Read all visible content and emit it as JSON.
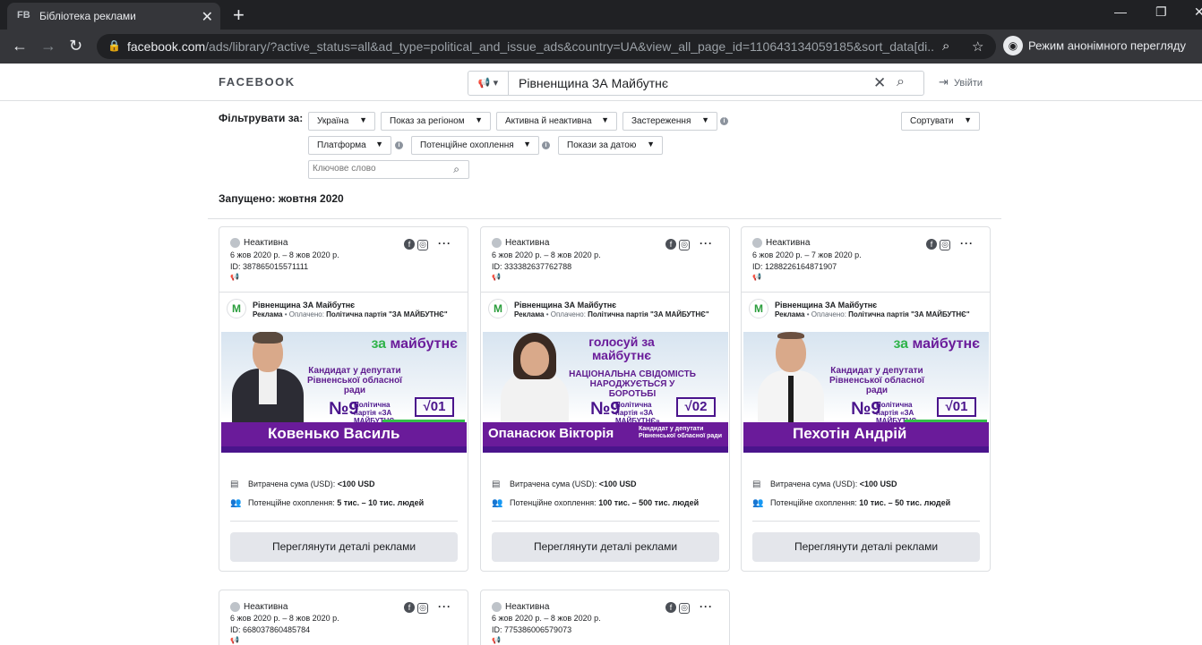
{
  "browser": {
    "tab_favicon": "FB",
    "tab_title": "Бібліотека реклами",
    "url_host": "facebook.com",
    "url_path": "/ads/library/?active_status=all&ad_type=political_and_issue_ads&country=UA&view_all_page_id=110643134059185&sort_data[di...",
    "incognito_label": "Режим анонімного перегляду"
  },
  "header": {
    "logo": "FACEBOOK",
    "search_value": "Рівненщина ЗА Майбутнє",
    "logout": "Увійти"
  },
  "filters": {
    "label": "Фільтрувати за:",
    "country": "Україна",
    "region": "Показ за регіоном",
    "status": "Активна й неактивна",
    "disclaimer": "Застереження",
    "sort": "Сортувати",
    "platform": "Платформа",
    "reach": "Потенційне охоплення",
    "date": "Покази за датою",
    "keyword_placeholder": "Ключове слово"
  },
  "launched_label": "Запущено: жовтня 2020",
  "ads": [
    {
      "status": "Неактивна",
      "date": "6 жов 2020 р. – 8 жов 2020 р.",
      "id": "ID: 387865015571111",
      "page": "Рівненщина ЗА Майбутнє",
      "ad_word": "Реклама",
      "paid_prefix": " • Оплачено: ",
      "paid_by": "Політична партія \"ЗА МАЙБУТНЄ\"",
      "brand_a": "за",
      "brand_b": "майбутнє",
      "subtitle": "Кандидат у депутати Рівненської обласної ради",
      "number": "№9",
      "party": "Політична партія «ЗА МАЙБУТНЄ»",
      "box": "√01",
      "candidate": "Ковенько Василь",
      "spent_label": "Витрачена сума (USD): ",
      "spent": "<100 USD",
      "reach_label": "Потенційне охоплення: ",
      "reach": "5 тис. – 10 тис. людей",
      "button": "Переглянути деталі реклами"
    },
    {
      "status": "Неактивна",
      "date": "6 жов 2020 р. – 8 жов 2020 р.",
      "id": "ID: 333382637762788",
      "page": "Рівненщина ЗА Майбутнє",
      "ad_word": "Реклама",
      "paid_prefix": " • Оплачено: ",
      "paid_by": "Політична партія \"ЗА МАЙБУТНЄ\"",
      "brand_a": "голосуй за",
      "brand_b": "майбутнє",
      "subtitle": "НАЦІОНАЛЬНА СВІДОМІСТЬ НАРОДЖУЄТЬСЯ У БОРОТЬБІ",
      "number": "№9",
      "party": "Політична партія «ЗА МАЙБУТНЄ»",
      "box": "√02",
      "candidate": "Опанасюк Вікторія",
      "band_note": "Кандидат у депутати Рівненської обласної ради",
      "spent_label": "Витрачена сума (USD): ",
      "spent": "<100 USD",
      "reach_label": "Потенційне охоплення: ",
      "reach": "100 тис. – 500 тис. людей",
      "button": "Переглянути деталі реклами"
    },
    {
      "status": "Неактивна",
      "date": "6 жов 2020 р. – 7 жов 2020 р.",
      "id": "ID: 1288226164871907",
      "page": "Рівненщина ЗА Майбутнє",
      "ad_word": "Реклама",
      "paid_prefix": " • Оплачено: ",
      "paid_by": "Політична партія \"ЗА МАЙБУТНЄ\"",
      "brand_a": "за",
      "brand_b": "майбутнє",
      "subtitle": "Кандидат у депутати Рівненської обласної ради",
      "number": "№9",
      "party": "Політична партія «ЗА МАЙБУТНЄ»",
      "box": "√01",
      "candidate": "Пехотін Андрій",
      "spent_label": "Витрачена сума (USD): ",
      "spent": "<100 USD",
      "reach_label": "Потенційне охоплення: ",
      "reach": "10 тис. – 50 тис. людей",
      "button": "Переглянути деталі реклами"
    },
    {
      "status": "Неактивна",
      "date": "6 жов 2020 р. – 8 жов 2020 р.",
      "id": "ID: 668037860485784"
    },
    {
      "status": "Неактивна",
      "date": "6 жов 2020 р. – 8 жов 2020 р.",
      "id": "ID: 775386006579073"
    }
  ]
}
